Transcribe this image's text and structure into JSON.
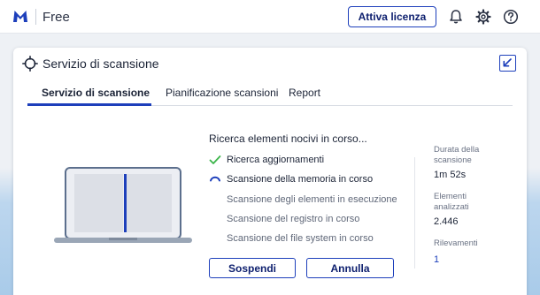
{
  "app": {
    "name": "Free"
  },
  "topbar": {
    "license_button": "Attiva licenza"
  },
  "icons": {
    "logo": "malwarebytes-logo",
    "bell": "bell-icon",
    "settings": "gear-icon",
    "help": "help-icon",
    "target": "target-icon",
    "collapse": "collapse-arrow-icon"
  },
  "colors": {
    "accent": "#1d3fbb",
    "check": "#3bb54a"
  },
  "card": {
    "title": "Servizio di scansione",
    "tabs": [
      {
        "label": "Servizio di scansione",
        "active": true
      },
      {
        "label": "Pianificazione scansioni",
        "active": false
      },
      {
        "label": "Report",
        "active": false
      }
    ]
  },
  "scan": {
    "heading": "Ricerca elementi nocivi in corso...",
    "steps": [
      {
        "label": "Ricerca aggiornamenti",
        "state": "done"
      },
      {
        "label": "Scansione della memoria in corso",
        "state": "active"
      },
      {
        "label": "Scansione degli elementi in esecuzione all'avvio in corso",
        "state": "pending"
      },
      {
        "label": "Scansione del registro in corso",
        "state": "pending"
      },
      {
        "label": "Scansione del file system in corso",
        "state": "pending"
      }
    ],
    "pause_button": "Sospendi",
    "cancel_button": "Annulla"
  },
  "stats": {
    "duration_label": "Durata della scansione",
    "duration_value": "1m 52s",
    "items_label": "Elementi analizzati",
    "items_value": "2.446",
    "detections_label": "Rilevamenti",
    "detections_value": "1"
  }
}
